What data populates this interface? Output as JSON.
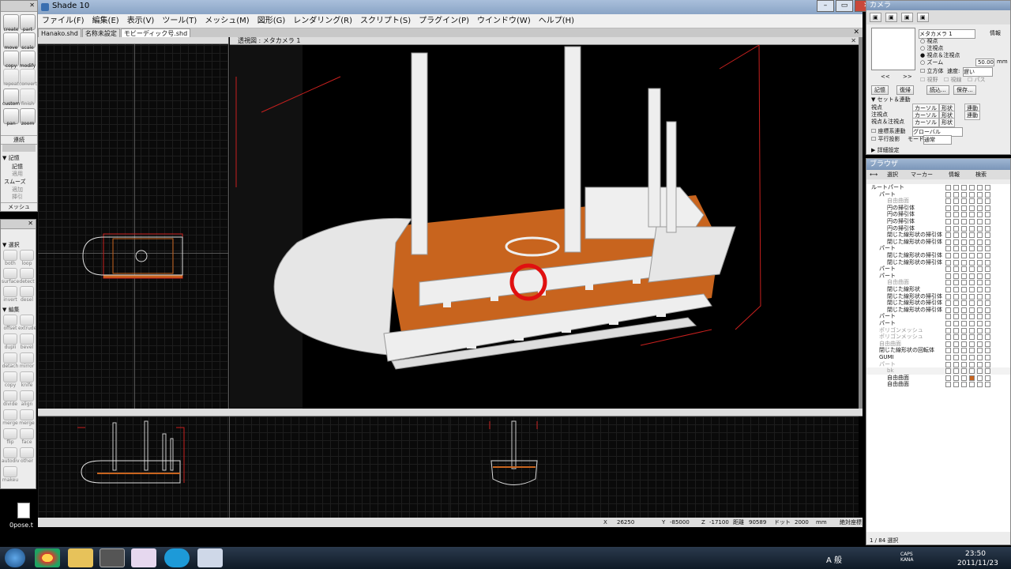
{
  "app": {
    "title": "Shade 10",
    "menu": [
      "ファイル(F)",
      "編集(E)",
      "表示(V)",
      "ツール(T)",
      "メッシュ(M)",
      "図形(G)",
      "レンダリング(R)",
      "スクリプト(S)",
      "プラグイン(P)",
      "ウインドウ(W)",
      "ヘルプ(H)"
    ],
    "tabs": [
      "Hanako.shd",
      "名称未設定",
      "モビーディック号.shd"
    ],
    "viewport_title": "透視図 : メタカメラ 1"
  },
  "toolbox": {
    "tools": [
      "create",
      "part",
      "move",
      "scale",
      "copy",
      "modify",
      "repeat",
      "convert",
      "custom",
      "finish",
      "pan",
      "zoom"
    ],
    "sec1": "連続",
    "sec2": "▼ 記憶",
    "mem_items": [
      "記憶",
      "適用"
    ],
    "smooth": "スムーズ",
    "smooth_items": [
      "適加",
      "挿引"
    ],
    "mesh": "メッシュ"
  },
  "meshbox": {
    "sel_header": "▼ 選択",
    "sel_tools": [
      "both",
      "loop",
      "surface",
      "detect",
      "invert",
      "desel"
    ],
    "edit_header": "▼ 編集",
    "edit_tools": [
      "offset",
      "extrude",
      "dupli",
      "bevel",
      "detach",
      "mirror",
      "copy",
      "knife",
      "divide",
      "align",
      "merge",
      "merge",
      "flip",
      "face",
      "autodiv",
      "other",
      "makeu"
    ]
  },
  "camera": {
    "title": "カメラ",
    "name": "メタカメラ 1",
    "info": "情報",
    "opts": [
      "視点",
      "注視点",
      "視点＆注視点",
      "ズーム"
    ],
    "zoom_val": "50.00",
    "zoom_unit": "mm",
    "cube": "立方体",
    "speed_label": "速度:",
    "speed_val": "遅い",
    "check2": [
      "視野",
      "視線",
      "パス"
    ],
    "buttons": [
      "記憶",
      "復帰",
      "読込...",
      "保存..."
    ],
    "nav": [
      "<<",
      ">>"
    ],
    "set_header": "▼ セット＆連動",
    "set_rows": [
      [
        "視点",
        "カーソル",
        "形状",
        "連動"
      ],
      [
        "注視点",
        "カーソル",
        "形状",
        "連動"
      ],
      [
        "視点＆注視点",
        "カーソル",
        "形状"
      ]
    ],
    "coord_label": "座標系連動",
    "coord_val": "グローバル",
    "parallel": "平行投影",
    "mode_label": "モード",
    "mode_val": "通常",
    "detail": "▶ 詳細設定"
  },
  "browser": {
    "title": "ブラウザ",
    "toolbar": [
      "選択",
      "マーカー",
      "情報",
      "検索"
    ],
    "items": [
      "ルートパート",
      "パート",
      "自由曲面",
      "円の掃引体",
      "円の掃引体",
      "円の掃引体",
      "円の掃引体",
      "閉じた線形状の掃引体",
      "閉じた線形状の掃引体",
      "パート",
      "閉じた線形状の掃引体",
      "閉じた線形状の掃引体",
      "パート",
      "パート",
      "自由曲面",
      "閉じた線形状",
      "閉じた線形状の掃引体",
      "閉じた線形状の掃引体",
      "閉じた線形状の掃引体",
      "パート",
      "パート",
      "ポリゴンメッシュ",
      "ポリゴンメッシュ",
      "自由曲面",
      "閉じた線形状の回転体",
      "GUMI",
      "パート",
      "bk",
      "自由曲面",
      "自由曲面"
    ],
    "status": "1 / 84 選択"
  },
  "status": {
    "x_label": "X",
    "x": "26250",
    "y_label": "Y",
    "y": "-85000",
    "z_label": "Z",
    "z": "-17100",
    "dist_label": "距離",
    "dist": "90589",
    "dot_label": "ドット",
    "dot": "2000",
    "unit": "mm",
    "coord_mode": "絶対座標"
  },
  "desktop": {
    "file_label": "0pose.t"
  },
  "taskbar": {
    "ime": "A 般",
    "caps": "CAPS KANA",
    "time": "23:50",
    "date": "2011/11/23"
  },
  "colors": {
    "deck": "#c8641e",
    "wire": "#c8201e",
    "grid": "#1d1d1d"
  }
}
